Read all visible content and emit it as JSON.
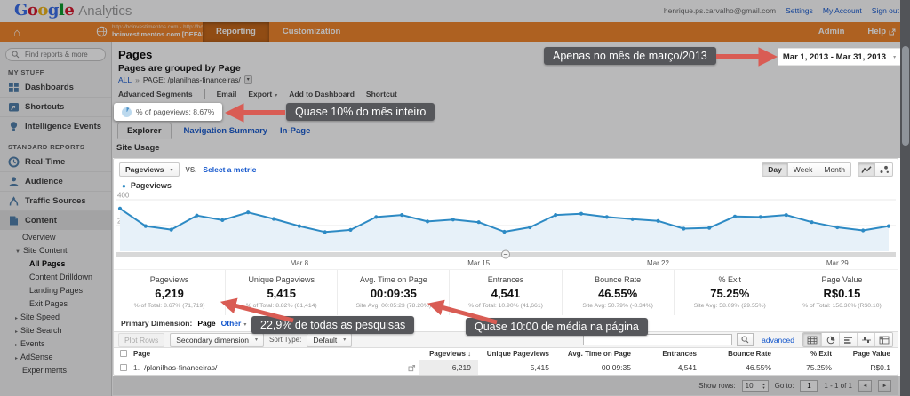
{
  "topbar": {
    "logo_letters": [
      "G",
      "o",
      "o",
      "g",
      "l",
      "e"
    ],
    "logo_suffix": "Analytics",
    "email": "henrique.ps.carvalho@gmail.com",
    "settings": "Settings",
    "my_account": "My Account",
    "sign_out": "Sign out"
  },
  "nav": {
    "account_line1": "http://hcinvestimentos.com - http://hcinvestimentos.com",
    "account_line2": "hcinvestimentos.com [DEFAULT]",
    "tab_reporting": "Reporting",
    "tab_customization": "Customization",
    "admin": "Admin",
    "help": "Help"
  },
  "sidebar": {
    "search_placeholder": "Find reports & more",
    "my_stuff_title": "MY STUFF",
    "my_stuff": [
      "Dashboards",
      "Shortcuts",
      "Intelligence Events"
    ],
    "standard_title": "STANDARD REPORTS",
    "standard": [
      "Real-Time",
      "Audience",
      "Traffic Sources",
      "Content"
    ],
    "content_items": [
      "Overview",
      "Site Content",
      "All Pages",
      "Content Drilldown",
      "Landing Pages",
      "Exit Pages",
      "Site Speed",
      "Site Search",
      "Events",
      "AdSense",
      "Experiments"
    ]
  },
  "header": {
    "title": "Pages",
    "subtitle": "Pages are grouped by Page",
    "breadcrumb_all": "ALL",
    "breadcrumb_sep": "»",
    "breadcrumb_page": "PAGE: /planilhas-financeiras/",
    "toolbar": [
      "Advanced Segments",
      "Email",
      "Export",
      "Add to Dashboard",
      "Shortcut"
    ],
    "date_range": "Mar 1, 2013 - Mar 31, 2013"
  },
  "badge": {
    "text": "% of pageviews: 8.67%"
  },
  "callouts": {
    "date": "Apenas no mês de março/2013",
    "badge": "Quase 10% do mês inteiro",
    "pageviews": "22,9% de todas as pesquisas",
    "avg_time": "Quase 10:00 de média na página"
  },
  "report_tabs": {
    "explorer": "Explorer",
    "navigation_summary": "Navigation Summary",
    "in_page": "In-Page",
    "section": "Site Usage"
  },
  "chart_controls": {
    "metric": "Pageviews",
    "vs": "VS.",
    "select_metric": "Select a metric",
    "granularity": [
      "Day",
      "Week",
      "Month"
    ],
    "legend": "Pageviews"
  },
  "chart_data": {
    "type": "line",
    "legend": "Pageviews",
    "date_start": "Mar 1, 2013",
    "date_end": "Mar 31, 2013",
    "values": [
      332,
      196,
      168,
      278,
      242,
      302,
      252,
      196,
      150,
      166,
      266,
      282,
      232,
      246,
      226,
      152,
      186,
      282,
      292,
      266,
      250,
      236,
      176,
      182,
      270,
      266,
      282,
      226,
      186,
      162,
      196
    ],
    "x_labels_visible": [
      "Mar 8",
      "Mar 15",
      "Mar 22",
      "Mar 29"
    ],
    "x_label_day_indices": [
      7,
      14,
      21,
      28
    ],
    "ylim": [
      0,
      400
    ],
    "yticks": [
      200,
      400
    ],
    "series_color": "#2d8ac4",
    "area_color": "#e7f1f9"
  },
  "metrics": [
    {
      "label": "Pageviews",
      "value": "6,219",
      "sub": "% of Total: 8.67% (71,719)"
    },
    {
      "label": "Unique Pageviews",
      "value": "5,415",
      "sub": "% of Total: 8.82% (61,414)"
    },
    {
      "label": "Avg. Time on Page",
      "value": "00:09:35",
      "sub": "Site Avg: 00:05:23 (78.20%)"
    },
    {
      "label": "Entrances",
      "value": "4,541",
      "sub": "% of Total: 10.90% (41,661)"
    },
    {
      "label": "Bounce Rate",
      "value": "46.55%",
      "sub": "Site Avg: 50.79% (-8.34%)"
    },
    {
      "label": "% Exit",
      "value": "75.25%",
      "sub": "Site Avg: 58.09% (29.55%)"
    },
    {
      "label": "Page Value",
      "value": "R$0.15",
      "sub": "% of Total: 156.30% (R$0.10)"
    }
  ],
  "dimension_bar": {
    "primary_label": "Primary Dimension:",
    "primary_value": "Page",
    "other": "Other",
    "plot_rows": "Plot Rows",
    "secondary": "Secondary dimension",
    "sort_type_label": "Sort Type:",
    "sort_type_value": "Default",
    "advanced": "advanced"
  },
  "table": {
    "headers": [
      "Page",
      "Pageviews",
      "Unique Pageviews",
      "Avg. Time on Page",
      "Entrances",
      "Bounce Rate",
      "% Exit",
      "Page Value"
    ],
    "row": {
      "index": "1.",
      "page": "/planilhas-financeiras/",
      "pageviews": "6,219",
      "unique_pageviews": "5,415",
      "avg_time_on_page": "00:09:35",
      "entrances": "4,541",
      "bounce_rate": "46.55%",
      "pct_exit": "75.25%",
      "page_value": "R$0.1"
    },
    "footer": {
      "show_rows_label": "Show rows:",
      "show_rows_value": "10",
      "goto_label": "Go to:",
      "goto_value": "1",
      "range": "1 - 1 of 1"
    }
  },
  "icons": {
    "caret_down": "▾",
    "caret_right": "▸",
    "caret_tree_open": "▼",
    "home": "⌂",
    "sort_desc": "↓",
    "legend_dot": "●",
    "prev": "◄",
    "next": "►",
    "stepper_up": "▴",
    "stepper_down": "▾"
  },
  "colors": {
    "accent_orange": "#ef8125",
    "link_blue": "#1155cc",
    "series_blue": "#2d8ac4",
    "arrow_red": "#d95c54"
  }
}
